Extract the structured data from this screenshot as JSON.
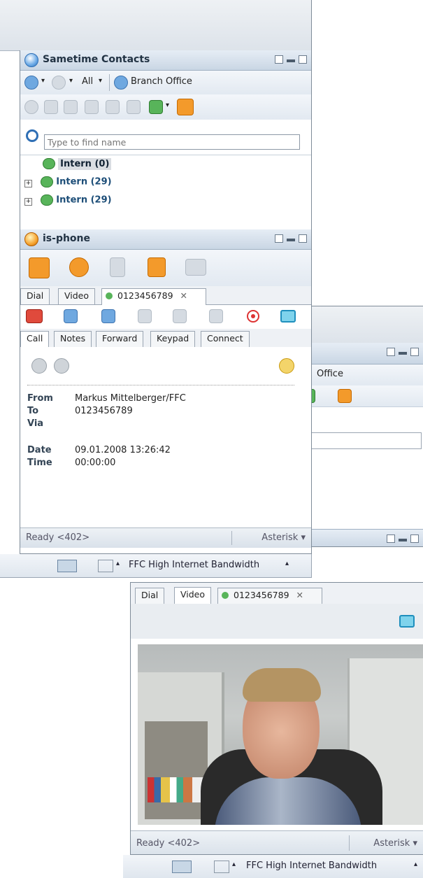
{
  "contacts": {
    "title": "Sametime Contacts",
    "toolbar": {
      "all_label": "All",
      "branch_label": "Branch Office"
    },
    "search_placeholder": "Type to find name",
    "groups": [
      {
        "label": "Intern (0)",
        "expanded": true
      },
      {
        "label": "Intern (29)",
        "expanded": false
      },
      {
        "label": "Intern (29)",
        "expanded": false
      }
    ]
  },
  "phone": {
    "title": "is-phone",
    "tabs": [
      "Dial",
      "Video",
      "0123456789"
    ],
    "call_tabs": [
      "Call",
      "Notes",
      "Forward",
      "Keypad",
      "Connect"
    ],
    "details": {
      "from_label": "From",
      "from_value": "Markus Mittelberger/FFC",
      "to_label": "To",
      "to_value": "0123456789",
      "via_label": "Via",
      "via_value": "",
      "date_label": "Date",
      "date_value": "09.01.2008 13:26:42",
      "time_label": "Time",
      "time_value": "00:00:00"
    },
    "status_left": "Ready <402>",
    "status_right": "Asterisk"
  },
  "tray": {
    "connection": "FFC High Internet Bandwidth"
  },
  "back_window": {
    "branch_fragment": "Office"
  },
  "video_window": {
    "tabs": [
      "Dial",
      "Video",
      "0123456789"
    ],
    "status_left": "Ready <402>",
    "status_right": "Asterisk",
    "tray_connection": "FFC High Internet Bandwidth"
  },
  "colors": {
    "accent": "#2f6fb5",
    "phone_orange": "#f39a2b",
    "chrome": "#dfe6ee"
  }
}
